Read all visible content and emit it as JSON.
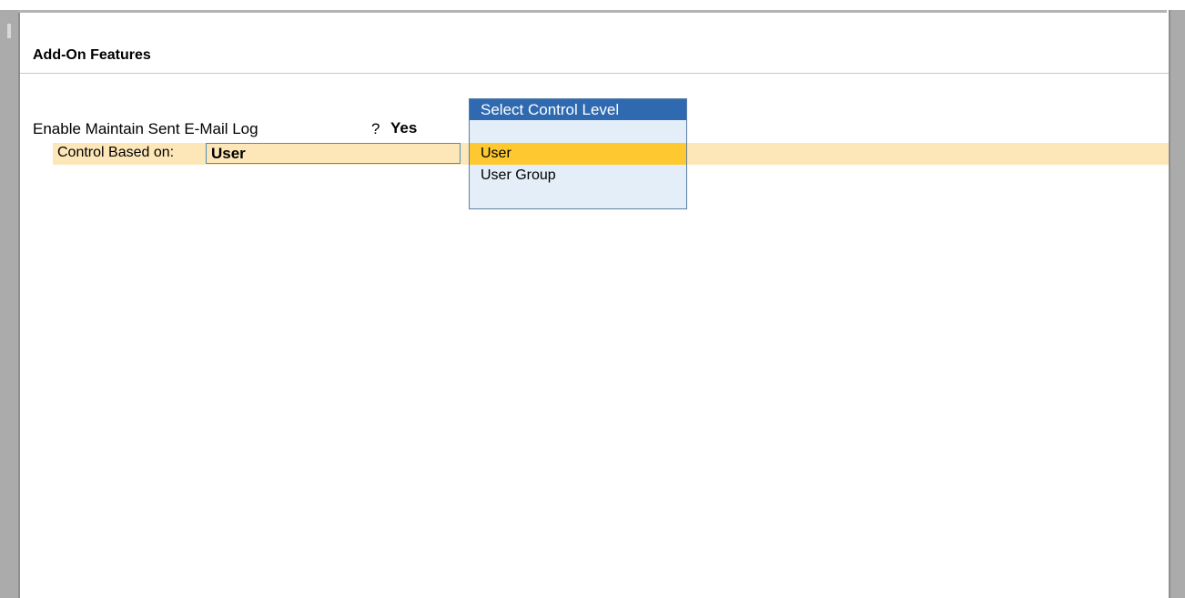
{
  "section": {
    "title": "Add-On Features"
  },
  "fields": {
    "email_log_label": "Enable Maintain Sent E-Mail Log",
    "email_log_prompt": "?",
    "email_log_value": "Yes",
    "control_label": "Control Based on:",
    "control_value": "User"
  },
  "dropdown": {
    "title": "Select Control Level",
    "options": [
      {
        "label": "User",
        "selected": true
      },
      {
        "label": "User Group",
        "selected": false
      }
    ]
  },
  "colors": {
    "highlight": "#fde7b9",
    "selected_option": "#fec830",
    "dropdown_header": "#2f6ab1",
    "dropdown_body": "#e3eef8"
  }
}
